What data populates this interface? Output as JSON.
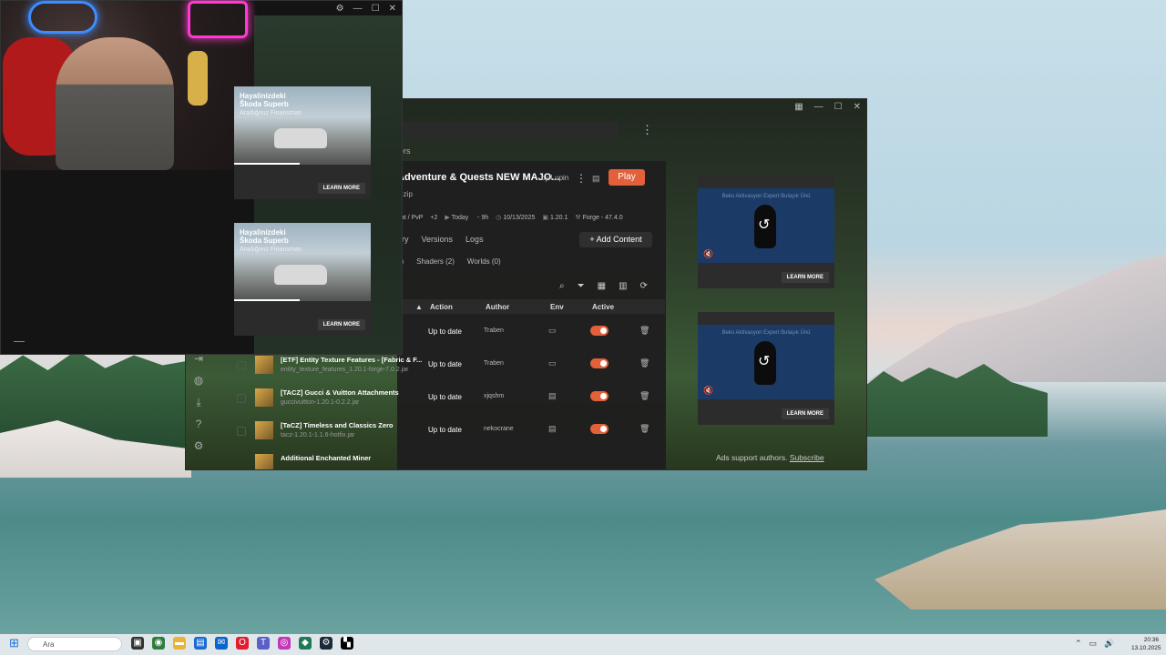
{
  "webcam_window": {
    "controls": {
      "settings": "⚙",
      "minimize": "—",
      "maximize": "☐",
      "close": "✕"
    }
  },
  "left_ads": [
    {
      "title_line1": "Hayalinizdeki",
      "title_line2": "Škoda Superb",
      "subtitle": "Aradığınız Finansman",
      "cta": "LEARN MORE",
      "progress": 0.48
    },
    {
      "title_line1": "Hayalinizdeki",
      "title_line2": "Škoda Superb",
      "subtitle": "Aradığınız Finansman",
      "cta": "LEARN MORE",
      "progress": 0.48
    }
  ],
  "app": {
    "window_controls": {
      "layout": "▦",
      "minimize": "—",
      "maximize": "☐",
      "close": "✕"
    },
    "partial_tab": "ers",
    "instance": {
      "name": "Adventure & Quests NEW MAJO...",
      "file": "0.zip",
      "by": "by Lupin",
      "play_label": "Play",
      "meta": {
        "tags": "hat / PvP",
        "tags_more": "+2",
        "last_played": "Today",
        "playtime": "9h",
        "date": "10/13/2025",
        "version": "1.20.1",
        "loader": "Forge - 47.4.0"
      }
    },
    "tabs": [
      "ery",
      "Versions",
      "Logs"
    ],
    "add_content_label": "+  Add Content",
    "subtabs": [
      "5)",
      "Shaders (2)",
      "Worlds (0)"
    ],
    "table_headers": {
      "sort": "▲",
      "action": "Action",
      "author": "Author",
      "env": "Env",
      "active": "Active"
    },
    "mods": [
      {
        "name": "",
        "file": "",
        "action": "Up to date",
        "author": "Traben",
        "env": "client"
      },
      {
        "name": "[ETF] Entity Texture Features - [Fabric & F...",
        "file": "entity_texture_features_1.20.1-forge-7.0.2.jar",
        "action": "Up to date",
        "author": "Traben",
        "env": "client"
      },
      {
        "name": "[TACZ] Gucci & Vuitton Attachments",
        "file": "guccivuitton-1.20.1-0.2.2.jar",
        "action": "Up to date",
        "author": "xjqshm",
        "env": "server"
      },
      {
        "name": "[TaCZ] Timeless and Classics Zero",
        "file": "tacz-1.20.1-1.1.6-hotfix.jar",
        "action": "Up to date",
        "author": "nekocrane",
        "env": "server"
      },
      {
        "name": "Additional Enchanted Miner",
        "file": "",
        "action": "",
        "author": "",
        "env": ""
      }
    ],
    "right_ads": [
      {
        "brand_text": "Beko Aktivasyon Expert Bulaşık Ünü",
        "cta": "LEARN MORE"
      },
      {
        "brand_text": "Beko Aktivasyon Expert Bulaşık Ünü",
        "cta": "LEARN MORE"
      }
    ],
    "ads_note": "Ads support authors.",
    "subscribe_label": "Subscribe"
  },
  "taskbar": {
    "search_placeholder": "Ara",
    "clock_time": "20:36",
    "clock_date": "13.10.2025"
  }
}
